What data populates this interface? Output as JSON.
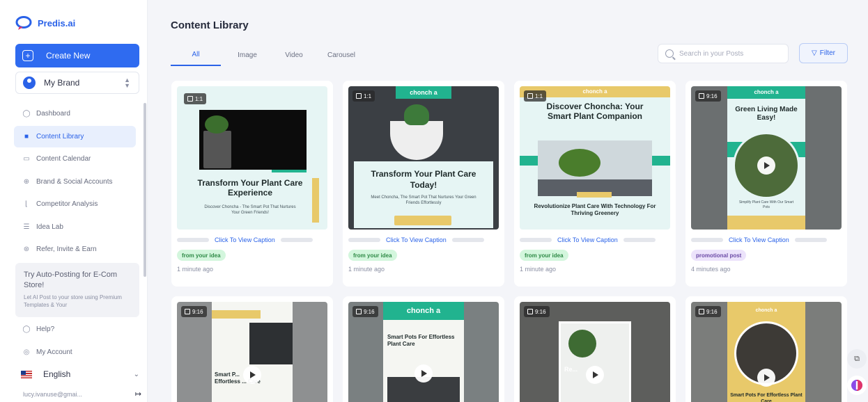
{
  "app": {
    "logo_text": "Predis.ai",
    "brand_color": "#2f6bf0"
  },
  "sidebar": {
    "create_label": "Create New",
    "brand_label": "My Brand",
    "items": [
      {
        "label": "Dashboard",
        "icon": "dashboard-icon"
      },
      {
        "label": "Content Library",
        "icon": "library-icon",
        "active": true
      },
      {
        "label": "Content Calendar",
        "icon": "calendar-icon"
      },
      {
        "label": "Brand & Social Accounts",
        "icon": "globe-icon"
      },
      {
        "label": "Competitor Analysis",
        "icon": "chart-icon"
      },
      {
        "label": "Idea Lab",
        "icon": "bulb-icon"
      },
      {
        "label": "Refer, Invite & Earn",
        "icon": "gift-icon"
      }
    ],
    "promo": {
      "title": "Try Auto-Posting for E-Com Store!",
      "text": "Let AI Post to your store using Premium Templates & Your"
    },
    "bottom_items": [
      {
        "label": "Help?",
        "icon": "help-icon"
      },
      {
        "label": "My Account",
        "icon": "account-icon"
      }
    ],
    "language": "English",
    "user_email": "lucy.ivanuse@gmai..."
  },
  "main": {
    "title": "Content Library",
    "tabs": [
      "All",
      "Image",
      "Video",
      "Carousel"
    ],
    "search_placeholder": "Search in your Posts",
    "filter_label": "Filter"
  },
  "cards": [
    {
      "ratio": "1:1",
      "caption": "Click To View Caption",
      "tag": "from your idea",
      "time": "1 minute ago",
      "headline": "Transform Your Plant Care Experience",
      "sub": "Discover Choncha - The Smart Pot That Nurtures Your Green Friends!"
    },
    {
      "ratio": "1:1",
      "caption": "Click To View Caption",
      "tag": "from your idea",
      "time": "1 minute ago",
      "brand": "chonch a",
      "headline": "Transform Your Plant Care Today!",
      "sub": "Meet Choncha, The Smart Pot That Nurtures Your Green Friends Effortlessly"
    },
    {
      "ratio": "1:1",
      "caption": "Click To View Caption",
      "tag": "from your idea",
      "time": "1 minute ago",
      "brand": "chonch a",
      "headline": "Discover Choncha: Your Smart Plant Companion",
      "sub": "Revolutionize Plant Care With Technology For Thriving Greenery"
    },
    {
      "ratio": "9:16",
      "caption": "Click To View Caption",
      "tag": "promotional post",
      "time": "4 minutes ago",
      "brand": "chonch a",
      "headline": "Green Living Made Easy!",
      "sub": "Simplify Plant Care With Our Smart Pots"
    },
    {
      "ratio": "9:16",
      "headline": "Smart P... Effortless ... Care"
    },
    {
      "ratio": "9:16",
      "brand": "chonch a",
      "headline": "Smart Pots For Effortless Plant Care"
    },
    {
      "ratio": "9:16",
      "headline": "Re..."
    },
    {
      "ratio": "9:16",
      "brand": "chonch a",
      "headline": "Smart Pots For Effortless Plant Care"
    }
  ]
}
